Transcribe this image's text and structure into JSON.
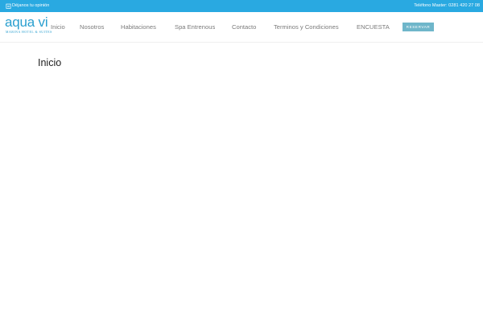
{
  "topbar": {
    "feedback_label": "Déjanos tu opinión",
    "phone_text": "Teléfono Master: 0281 420 27 08",
    "background_color": "#29a9e1"
  },
  "logo": {
    "wordmark": "aqua vi",
    "tagline": "MARINA HOTEL & SUITES",
    "color": "#2a9fcf"
  },
  "nav": {
    "items": [
      {
        "label": "Inicio"
      },
      {
        "label": "Nosotros"
      },
      {
        "label": "Habitaciones"
      },
      {
        "label": "Spa Entrenous"
      },
      {
        "label": "Contacto"
      },
      {
        "label": "Terminos y Condiciones"
      },
      {
        "label": "ENCUESTA"
      }
    ],
    "reserve_label": "RESERVAR",
    "reserve_color": "#6fb6ca"
  },
  "page": {
    "title": "Inicio"
  },
  "icons": {
    "feedback": "clipboard-icon"
  }
}
